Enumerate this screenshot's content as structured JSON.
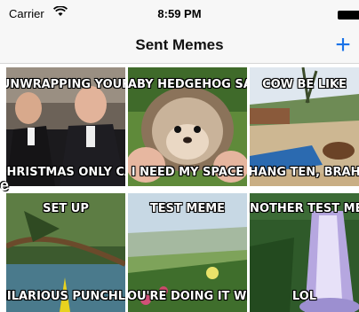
{
  "status_bar": {
    "carrier": "Carrier",
    "time": "8:59 PM"
  },
  "nav": {
    "title": "Sent Memes",
    "add_label": "+"
  },
  "colors": {
    "accent": "#1a73e8",
    "bar_background": "#f7f7f7"
  },
  "memes": [
    {
      "top": "UNWRAPPING YOUR",
      "bottom": "CHRISTMAS ONLY CA"
    },
    {
      "top": "BABY HEDGEHOG SAY",
      "bottom": "I NEED MY SPACE"
    },
    {
      "top": "COW BE LIKE",
      "bottom": "HANG TEN, BRAH"
    },
    {
      "top": "SET UP",
      "bottom": "HILARIOUS PUNCHLINE"
    },
    {
      "top": "TEST MEME",
      "bottom": "YOU'RE DOING IT WRONG"
    },
    {
      "top": "ANOTHER TEST MEME",
      "bottom": "LOL"
    }
  ],
  "edge_fragment": "e"
}
